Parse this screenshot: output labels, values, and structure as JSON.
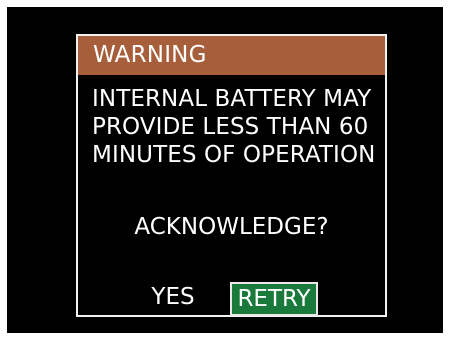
{
  "dialog": {
    "title": "WARNING",
    "message_lines": [
      "INTERNAL BATTERY MAY",
      "PROVIDE LESS THAN 60",
      "MINUTES OF OPERATION"
    ],
    "question": "ACKNOWLEDGE?",
    "buttons": {
      "yes": "YES",
      "retry": "RETRY"
    },
    "selected_button": "retry"
  },
  "colors": {
    "background": "#000000",
    "header": "#a65f3a",
    "selected_button": "#1a7a3c",
    "text": "#ffffff",
    "border": "#f2f2f2"
  }
}
